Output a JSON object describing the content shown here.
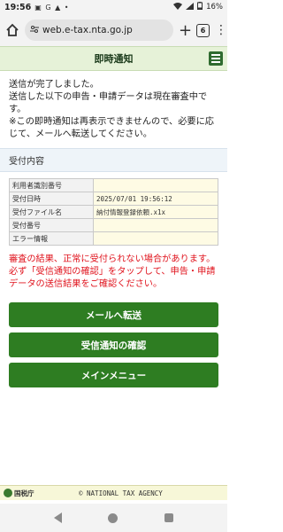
{
  "status_bar": {
    "time": "19:56",
    "icons": "▣ G ▲ •",
    "battery": "16%"
  },
  "browser": {
    "url": "web.e-tax.nta.go.jp",
    "tab_count": "6"
  },
  "header": {
    "title": "即時通知"
  },
  "message": [
    "送信が完了しました。",
    "送信した以下の申告・申請データは現在審査中です。",
    "※この即時通知は再表示できませんので、必要に応じて、メールへ転送してください。"
  ],
  "section": {
    "title": "受付内容"
  },
  "table": {
    "rows": [
      {
        "label": "利用者識別番号",
        "value": ""
      },
      {
        "label": "受付日時",
        "value": "2025/07/01 19:56:12"
      },
      {
        "label": "受付ファイル名",
        "value": "納付情報登録依頼.x1x"
      },
      {
        "label": "受付番号",
        "value": ""
      },
      {
        "label": "エラー情報",
        "value": ""
      }
    ]
  },
  "warning": [
    "審査の結果、正常に受付られない場合があります。",
    "必ず「受信通知の確認」をタップして、申告・申請データの送信結果をご確認ください。"
  ],
  "buttons": {
    "forward_email": "メールへ転送",
    "check_receipt": "受信通知の確認",
    "main_menu": "メインメニュー"
  },
  "footer": {
    "logo_text": "国税庁",
    "copyright": "© NATIONAL TAX AGENCY"
  },
  "colors": {
    "button_green": "#2e7d22",
    "header_bg": "#e6f2d8",
    "warning_red": "#e0141e"
  }
}
